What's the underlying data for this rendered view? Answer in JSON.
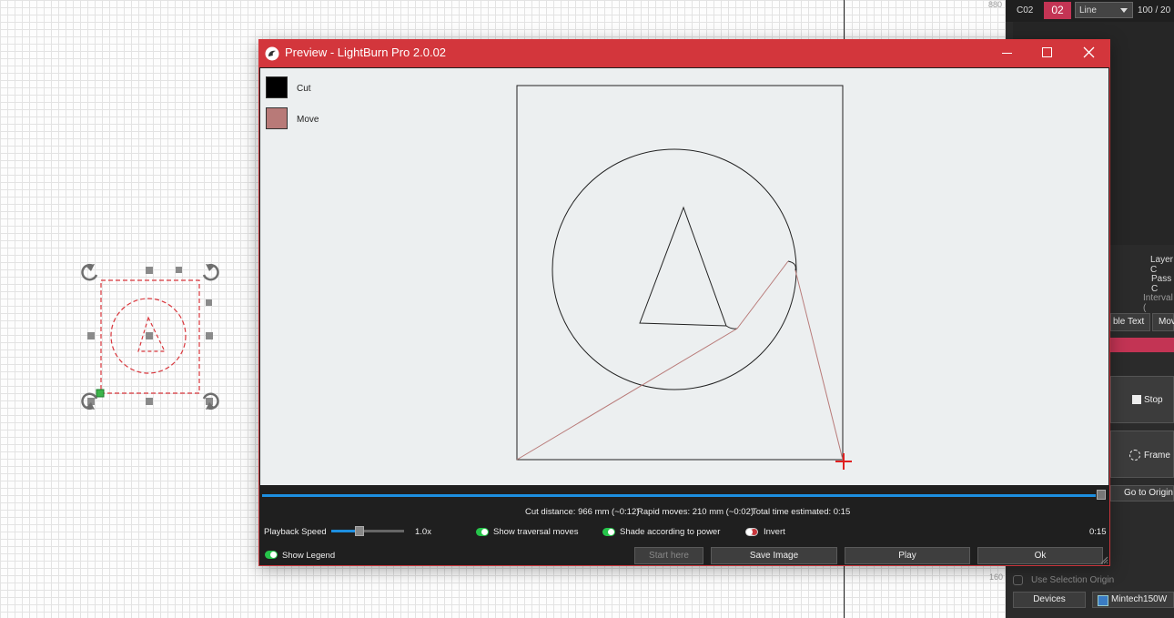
{
  "workspace": {
    "ruler_top": "880",
    "ruler_bottom": "160"
  },
  "right_panel": {
    "layer_id": "C02",
    "layer_number": "02",
    "mode": "Line",
    "speed_power": "100 / 20",
    "layer_label": "Layer C",
    "pass_label": "Pass C",
    "interval_label": "Interval (",
    "tab_variable_text": "ble Text",
    "tab_move": "Mov",
    "stop_label": "Stop",
    "frame_label": "Frame",
    "go_to_origin_label": "Go to Origin",
    "use_selection_origin_label": "Use Selection Origin",
    "devices_label": "Devices",
    "device_name": "Mintech150W",
    "accent_color": "#c33454"
  },
  "preview_window": {
    "title": "Preview - LightBurn Pro 2.0.02",
    "legend": [
      {
        "label": "Cut",
        "color": "#000000"
      },
      {
        "label": "Move",
        "color": "#b87a78"
      }
    ],
    "stats": {
      "cut_distance": "Cut distance: 966 mm (~0:12)",
      "rapid_moves": "Rapid moves: 210 mm (~0:02)",
      "total_time": "Total time estimated: 0:15"
    },
    "playback_speed_label": "Playback Speed",
    "playback_speed_value": "1.0x",
    "show_traversal_label": "Show traversal moves",
    "shade_power_label": "Shade according to power",
    "invert_label": "Invert",
    "elapsed_time": "0:15",
    "show_legend_label": "Show Legend",
    "buttons": {
      "start_here": "Start here",
      "save_image": "Save Image",
      "play": "Play",
      "ok": "Ok"
    },
    "title_bar_color": "#d3363c"
  }
}
